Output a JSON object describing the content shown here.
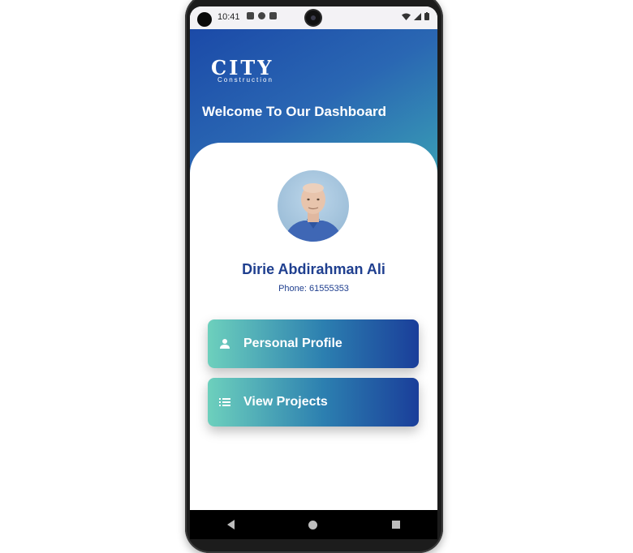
{
  "status_bar": {
    "time": "10:41",
    "icons": [
      "gallery-icon",
      "data-saver-icon",
      "sim-icon"
    ],
    "right_icons": [
      "wifi-icon",
      "signal-icon",
      "battery-icon"
    ]
  },
  "header": {
    "logo_main": "CITY",
    "logo_sub": "Construction",
    "welcome": "Welcome To Our Dashboard"
  },
  "user": {
    "name": "Dirie Abdirahman Ali",
    "phone": "Phone: 61555353"
  },
  "menu": {
    "personal_profile": "Personal Profile",
    "view_projects": "View Projects"
  },
  "nav": [
    "back-icon",
    "home-icon",
    "recent-apps-icon"
  ],
  "colors": {
    "primary": "#1f3f8f",
    "gradient_start": "#6dd0bd",
    "gradient_end": "#1a3e9a"
  }
}
